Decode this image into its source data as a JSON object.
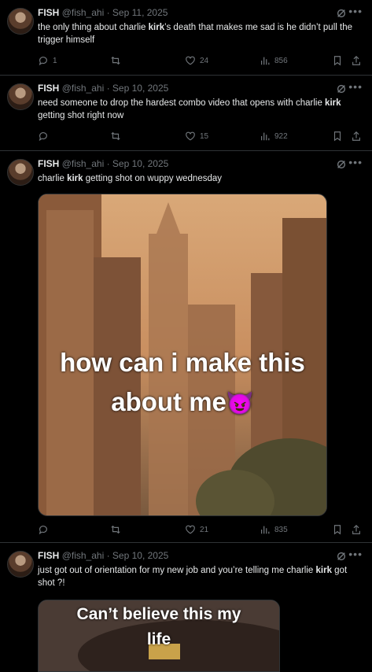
{
  "posts": [
    {
      "author": "FISH",
      "handle": "@fish_ahi",
      "date": "Sep 11, 2025",
      "text_before": "the only thing about charlie ",
      "keyword": "kirk",
      "text_after": "’s death that makes me sad is he didn’t pull the trigger himself",
      "replies": "1",
      "retweets": "",
      "likes": "24",
      "views": "856"
    },
    {
      "author": "FISH",
      "handle": "@fish_ahi",
      "date": "Sep 10, 2025",
      "text_before": "need someone to drop the hardest combo video that opens with charlie ",
      "keyword": "kirk",
      "text_after": " getting shot right now",
      "replies": "",
      "retweets": "",
      "likes": "15",
      "views": "922"
    },
    {
      "author": "FISH",
      "handle": "@fish_ahi",
      "date": "Sep 10, 2025",
      "text_before": "charlie ",
      "keyword": "kirk",
      "text_after": " getting shot on wuppy wednesday",
      "media_caption_line1": "how can i make this",
      "media_caption_line2": "about me",
      "media_emoji": "😈",
      "replies": "",
      "retweets": "",
      "likes": "21",
      "views": "835"
    },
    {
      "author": "FISH",
      "handle": "@fish_ahi",
      "date": "Sep 10, 2025",
      "text_before": "just got out of orientation for my new job and you’re telling me charlie ",
      "keyword": "kirk",
      "text_after": " got shot ?!",
      "media_caption_line1": "Can’t believe this my",
      "media_caption_line2": "life"
    }
  ],
  "icons": {
    "reply": "reply-icon",
    "retweet": "retweet-icon",
    "like": "heart-icon",
    "views": "views-icon",
    "bookmark": "bookmark-icon",
    "share": "share-icon",
    "grok": "grok-icon",
    "more": "more-icon"
  },
  "colors": {
    "background": "#000000",
    "text": "#e7e9ea",
    "muted": "#71767b",
    "divider": "#2f3336"
  }
}
